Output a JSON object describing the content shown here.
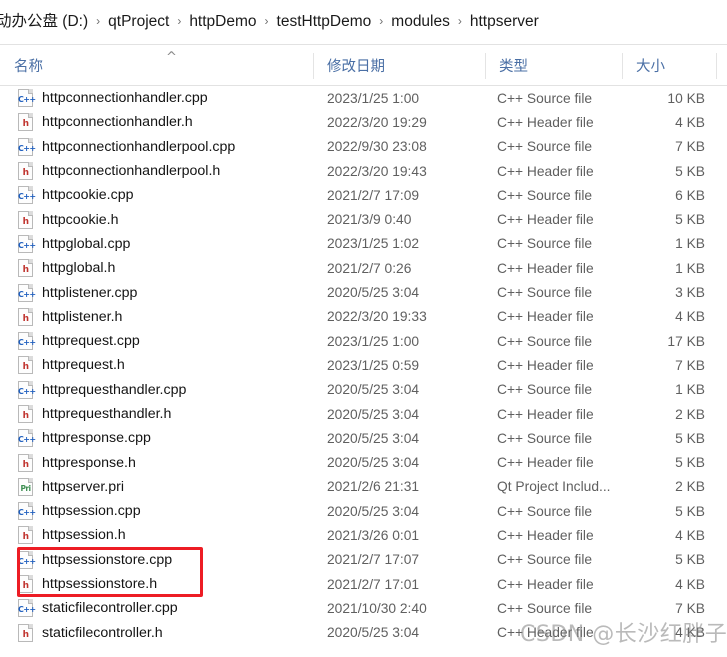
{
  "breadcrumb": {
    "separator": "›",
    "crumbs": [
      "动办公盘 (D:)",
      "qtProject",
      "httpDemo",
      "testHttpDemo",
      "modules",
      "httpserver"
    ]
  },
  "columns": {
    "name": "名称",
    "date_modified": "修改日期",
    "type": "类型",
    "size": "大小",
    "sort_indicator": "^"
  },
  "files": [
    {
      "name": "httpconnectionhandler.cpp",
      "icon": "cpp-file-icon",
      "icon_tag": "C++",
      "date": "2023/1/25 1:00",
      "type": "C++ Source file",
      "size": "10 KB"
    },
    {
      "name": "httpconnectionhandler.h",
      "icon": "h-file-icon",
      "icon_tag": "h",
      "date": "2022/3/20 19:29",
      "type": "C++ Header file",
      "size": "4 KB"
    },
    {
      "name": "httpconnectionhandlerpool.cpp",
      "icon": "cpp-file-icon",
      "icon_tag": "C++",
      "date": "2022/9/30 23:08",
      "type": "C++ Source file",
      "size": "7 KB"
    },
    {
      "name": "httpconnectionhandlerpool.h",
      "icon": "h-file-icon",
      "icon_tag": "h",
      "date": "2022/3/20 19:43",
      "type": "C++ Header file",
      "size": "5 KB"
    },
    {
      "name": "httpcookie.cpp",
      "icon": "cpp-file-icon",
      "icon_tag": "C++",
      "date": "2021/2/7 17:09",
      "type": "C++ Source file",
      "size": "6 KB"
    },
    {
      "name": "httpcookie.h",
      "icon": "h-file-icon",
      "icon_tag": "h",
      "date": "2021/3/9 0:40",
      "type": "C++ Header file",
      "size": "5 KB"
    },
    {
      "name": "httpglobal.cpp",
      "icon": "cpp-file-icon",
      "icon_tag": "C++",
      "date": "2023/1/25 1:02",
      "type": "C++ Source file",
      "size": "1 KB"
    },
    {
      "name": "httpglobal.h",
      "icon": "h-file-icon",
      "icon_tag": "h",
      "date": "2021/2/7 0:26",
      "type": "C++ Header file",
      "size": "1 KB"
    },
    {
      "name": "httplistener.cpp",
      "icon": "cpp-file-icon",
      "icon_tag": "C++",
      "date": "2020/5/25 3:04",
      "type": "C++ Source file",
      "size": "3 KB"
    },
    {
      "name": "httplistener.h",
      "icon": "h-file-icon",
      "icon_tag": "h",
      "date": "2022/3/20 19:33",
      "type": "C++ Header file",
      "size": "4 KB"
    },
    {
      "name": "httprequest.cpp",
      "icon": "cpp-file-icon",
      "icon_tag": "C++",
      "date": "2023/1/25 1:00",
      "type": "C++ Source file",
      "size": "17 KB"
    },
    {
      "name": "httprequest.h",
      "icon": "h-file-icon",
      "icon_tag": "h",
      "date": "2023/1/25 0:59",
      "type": "C++ Header file",
      "size": "7 KB"
    },
    {
      "name": "httprequesthandler.cpp",
      "icon": "cpp-file-icon",
      "icon_tag": "C++",
      "date": "2020/5/25 3:04",
      "type": "C++ Source file",
      "size": "1 KB"
    },
    {
      "name": "httprequesthandler.h",
      "icon": "h-file-icon",
      "icon_tag": "h",
      "date": "2020/5/25 3:04",
      "type": "C++ Header file",
      "size": "2 KB"
    },
    {
      "name": "httpresponse.cpp",
      "icon": "cpp-file-icon",
      "icon_tag": "C++",
      "date": "2020/5/25 3:04",
      "type": "C++ Source file",
      "size": "5 KB"
    },
    {
      "name": "httpresponse.h",
      "icon": "h-file-icon",
      "icon_tag": "h",
      "date": "2020/5/25 3:04",
      "type": "C++ Header file",
      "size": "5 KB"
    },
    {
      "name": "httpserver.pri",
      "icon": "pri-file-icon",
      "icon_tag": "Pri",
      "date": "2021/2/6 21:31",
      "type": "Qt Project Includ...",
      "size": "2 KB"
    },
    {
      "name": "httpsession.cpp",
      "icon": "cpp-file-icon",
      "icon_tag": "C++",
      "date": "2020/5/25 3:04",
      "type": "C++ Source file",
      "size": "5 KB"
    },
    {
      "name": "httpsession.h",
      "icon": "h-file-icon",
      "icon_tag": "h",
      "date": "2021/3/26 0:01",
      "type": "C++ Header file",
      "size": "4 KB"
    },
    {
      "name": "httpsessionstore.cpp",
      "icon": "cpp-file-icon",
      "icon_tag": "C++",
      "date": "2021/2/7 17:07",
      "type": "C++ Source file",
      "size": "5 KB"
    },
    {
      "name": "httpsessionstore.h",
      "icon": "h-file-icon",
      "icon_tag": "h",
      "date": "2021/2/7 17:01",
      "type": "C++ Header file",
      "size": "4 KB"
    },
    {
      "name": "staticfilecontroller.cpp",
      "icon": "cpp-file-icon",
      "icon_tag": "C++",
      "date": "2021/10/30 2:40",
      "type": "C++ Source file",
      "size": "7 KB"
    },
    {
      "name": "staticfilecontroller.h",
      "icon": "h-file-icon",
      "icon_tag": "h",
      "date": "2020/5/25 3:04",
      "type": "C++ Header file",
      "size": "4 KB"
    }
  ],
  "annotation": {
    "highlight_color": "#ed1c24",
    "highlighted_rows": [
      19,
      20
    ]
  },
  "watermark": {
    "text": "CSDN @长沙红胖子Qt"
  }
}
